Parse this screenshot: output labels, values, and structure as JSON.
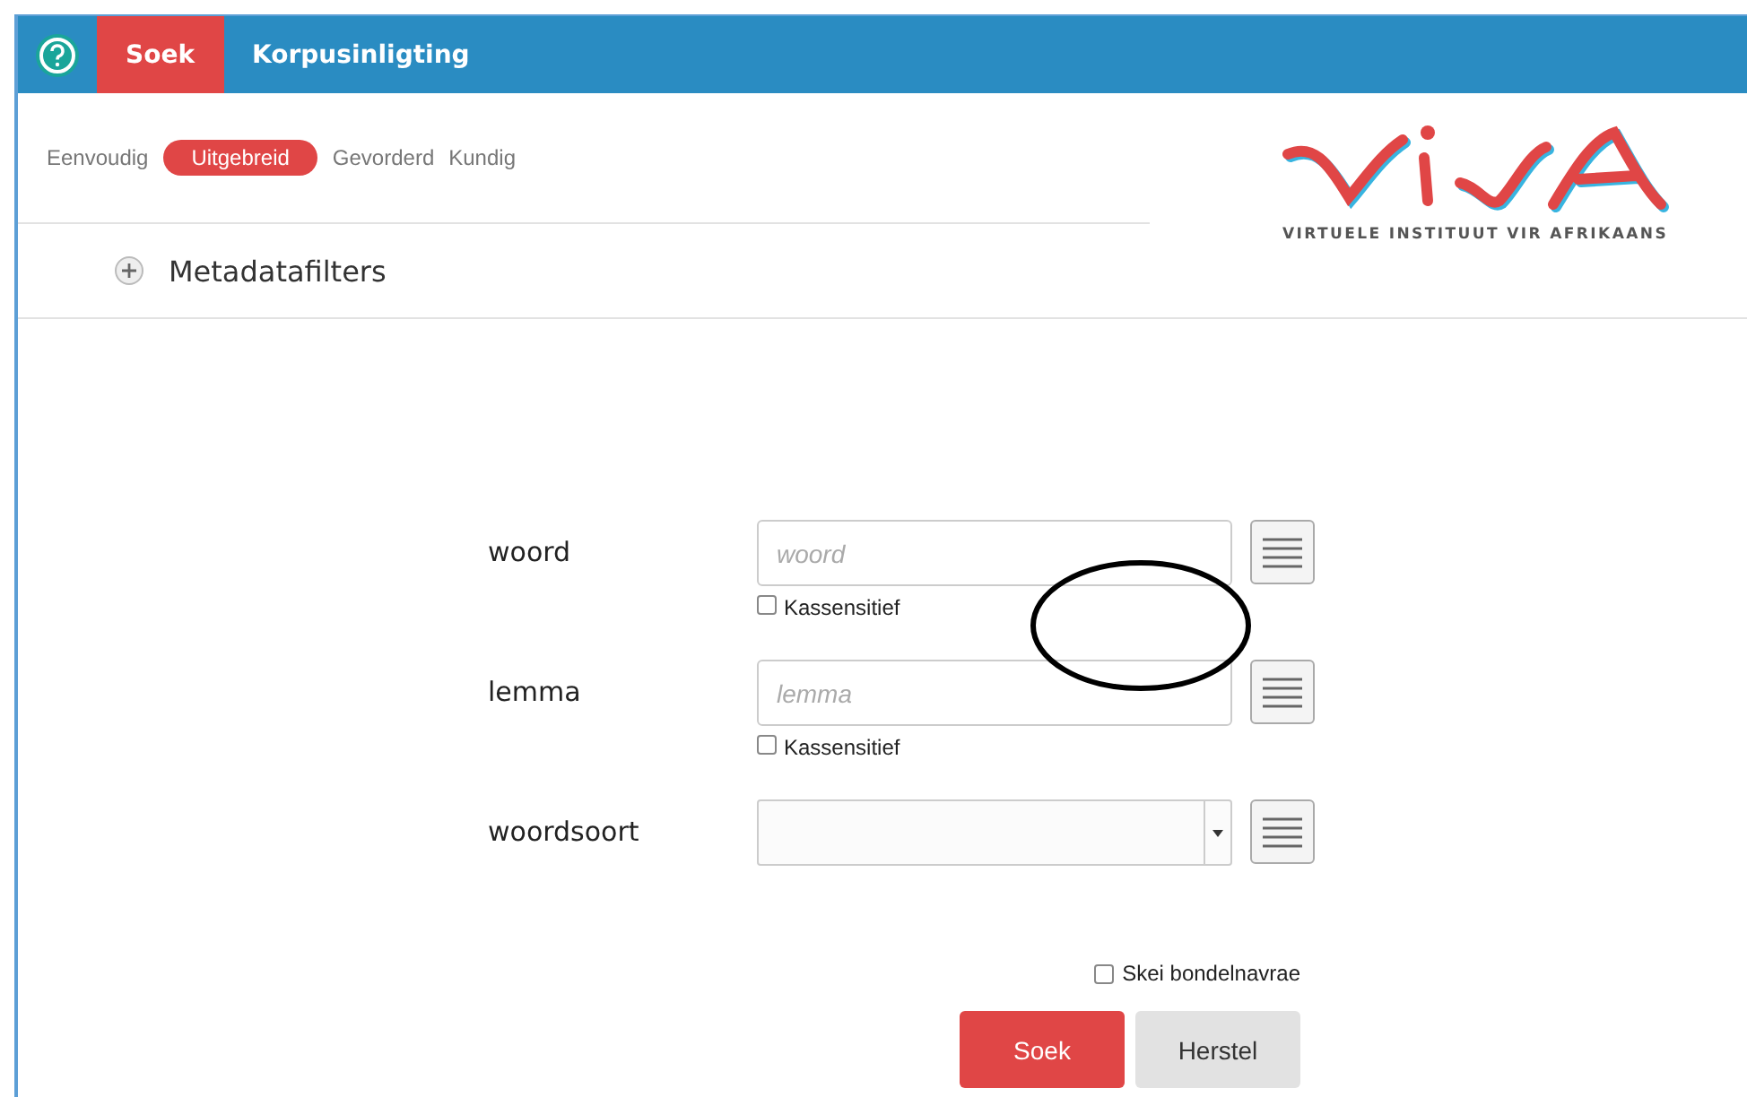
{
  "nav": {
    "tabs": [
      {
        "label": "Soek",
        "selected": true
      },
      {
        "label": "Korpusinligting",
        "selected": false
      }
    ]
  },
  "modes": [
    {
      "label": "Eenvoudig",
      "selected": false
    },
    {
      "label": "Uitgebreid",
      "selected": true
    },
    {
      "label": "Gevorderd",
      "selected": false
    },
    {
      "label": "Kundig",
      "selected": false
    }
  ],
  "metadata": {
    "label": "Metadatafilters",
    "expanded": false
  },
  "logo": {
    "subtitle": "VIRTUELE INSTITUUT VIR AFRIKAANS"
  },
  "fields": [
    {
      "kind": "text",
      "label": "woord",
      "placeholder": "woord",
      "option": {
        "label": "Kassensitief",
        "checked": false
      }
    },
    {
      "kind": "text",
      "label": "lemma",
      "placeholder": "lemma",
      "option": {
        "label": "Kassensitief",
        "checked": false
      }
    },
    {
      "kind": "select",
      "label": "woordsoort"
    }
  ],
  "batch": {
    "label": "Skei bondelnavrae",
    "checked": false
  },
  "buttons": [
    {
      "kind": "primary",
      "label": "Soek"
    },
    {
      "kind": "secondary",
      "label": "Herstel"
    }
  ]
}
